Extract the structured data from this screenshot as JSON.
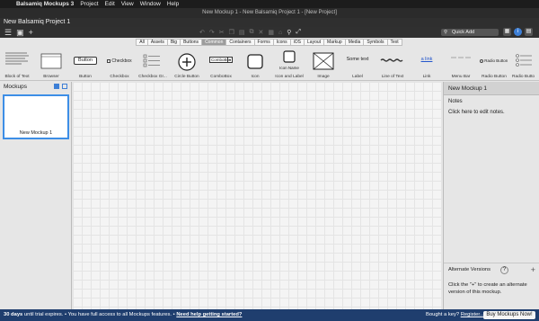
{
  "menubar": {
    "app": "Balsamiq Mockups 3",
    "items": [
      "Project",
      "Edit",
      "View",
      "Window",
      "Help"
    ]
  },
  "window_title": "New Mockup 1 - New Balsamiq Project 1 - [New Project]",
  "project_title": "New Balsamiq Project 1",
  "search": {
    "placeholder": "Quick Add"
  },
  "library_tabs": [
    "All",
    "Assets",
    "Big",
    "Buttons",
    "Common",
    "Containers",
    "Forms",
    "Icons",
    "iOS",
    "Layout",
    "Markup",
    "Media",
    "Symbols",
    "Text"
  ],
  "active_tab": "Common",
  "components": {
    "block_of_text": "Block of Text",
    "browser": "Browser",
    "button": "Button",
    "button_text": "Button",
    "checkbox": "Checkbox",
    "checkbox_text": "Checkbox",
    "checkbox_group": "Checkbox Gr...",
    "circle_button": "Circle Button",
    "combobox": "ComboBox",
    "combobox_text": "ComboBox",
    "icon": "Icon",
    "icon_and_label": "Icon and Label",
    "icon_name": "Icon Name",
    "image": "Image",
    "label": "Label",
    "label_text": "Some text",
    "line_of_text": "Line of Text",
    "link": "Link",
    "link_text": "a link",
    "menu_bar": "Menu Bar",
    "radio_button": "Radio Button",
    "radio_button_text": "Radio Button",
    "radio_button_group": "Radio Butto"
  },
  "left_panel": {
    "title": "Mockups",
    "mockups": [
      "New Mockup 1"
    ]
  },
  "right_panel": {
    "title": "New Mockup 1",
    "notes_label": "Notes",
    "notes_hint": "Click here to edit notes.",
    "alt_versions": "Alternate Versions",
    "alt_help": "?",
    "alt_desc": "Click the \"+\" to create an alternate version of this mockup."
  },
  "status": {
    "trial_days": "30 days",
    "trial_text": "until trial expires.",
    "full_access": "You have full access to all Mockups features.",
    "help_link": "Need help getting started?",
    "bought": "Bought a key?",
    "register": "Register...",
    "buy_button": "Buy Mockups Now!"
  },
  "colors": {
    "accent": "#3d8ee6",
    "statusbar": "#1f3e6e",
    "dark_chrome": "#2f2f2f"
  }
}
